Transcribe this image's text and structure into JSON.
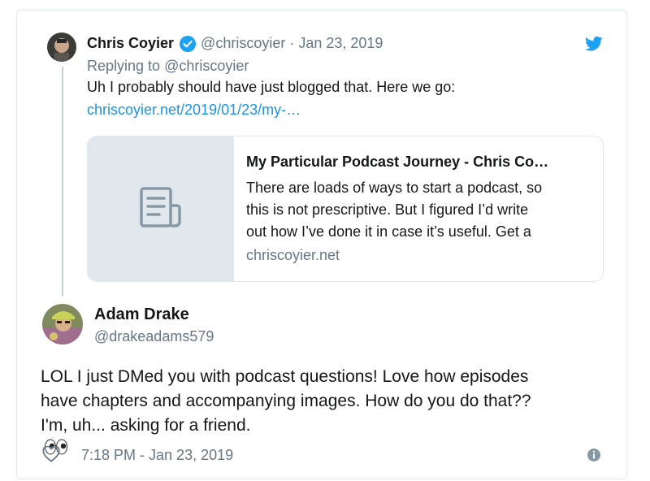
{
  "parent_tweet": {
    "author_name": "Chris Coyier",
    "handle": "@chriscoyier",
    "separator": "·",
    "date": "Jan 23, 2019",
    "replying_prefix": "Replying to",
    "replying_to": "@chriscoyier",
    "text": "Uh I probably should have just blogged that. Here we go:",
    "link_text": "chriscoyier.net/2019/01/23/my-…",
    "card": {
      "title": "My Particular Podcast Journey - Chris Co…",
      "description_lines": [
        "There are loads of ways to start a podcast, so",
        "this is not prescriptive. But I figured I’d write",
        "out how I’ve done it in case it’s useful. Get a"
      ],
      "domain": "chriscoyier.net",
      "thumbnail_icon": "document-icon"
    },
    "verified_icon": "verified-badge-icon"
  },
  "main_tweet": {
    "author_name": "Adam Drake",
    "handle": "@drakeadams579",
    "text_lines": [
      "LOL I just DMed you with podcast questions! Love how episodes",
      "have chapters and accompanying images. How do you do that??",
      "I'm, uh... asking for a friend."
    ],
    "emoji": "👀",
    "timestamp": "7:18 PM - Jan 23, 2019"
  },
  "icons": {
    "brand": "twitter-bird-icon",
    "like": "heart-icon",
    "info": "info-icon"
  },
  "colors": {
    "twitter_blue": "#1da1f2",
    "link": "#1b95e0",
    "secondary_text": "#657786",
    "border": "#e1e8ed"
  }
}
